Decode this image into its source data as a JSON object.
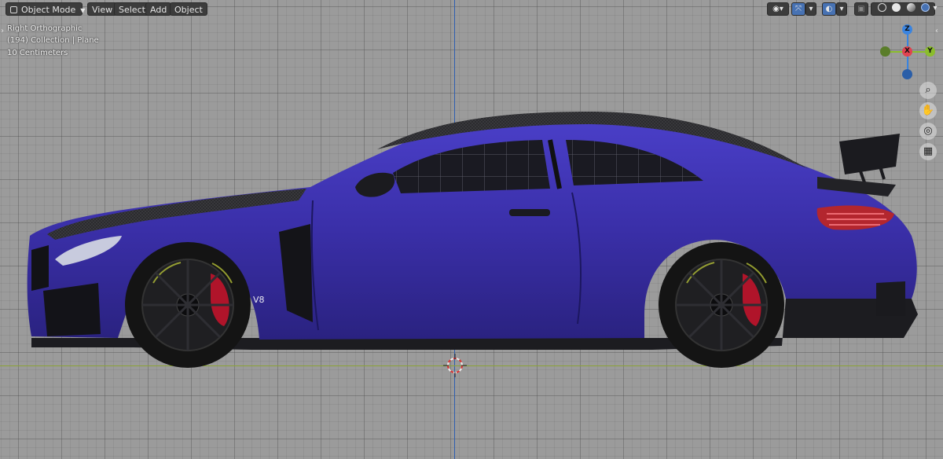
{
  "header": {
    "mode_label": "Object Mode",
    "menus": [
      "View",
      "Select",
      "Add",
      "Object"
    ]
  },
  "overlay": {
    "view_name": "Right Orthographic",
    "collection_info": "(194) Collection | Plane",
    "scale_info": "10 Centimeters"
  },
  "gizmo": {
    "z_label": "Z",
    "x_label": "X",
    "y_label": "Y",
    "colors": {
      "x": "#e0434f",
      "y": "#8bbd2c",
      "z": "#3a84e0"
    }
  },
  "icons": {
    "right_header": [
      "visibility-icon",
      "gizmo-toggle-icon",
      "overlay-icon",
      "xray-icon",
      "wireframe-shading-icon",
      "solid-shading-icon",
      "material-shading-icon",
      "rendered-shading-icon"
    ],
    "navigation": [
      "zoom-icon",
      "pan-hand-icon",
      "camera-view-icon",
      "grid-ortho-icon"
    ]
  },
  "model": {
    "body_color": "#3a2fa8",
    "badge_text": "V8"
  }
}
